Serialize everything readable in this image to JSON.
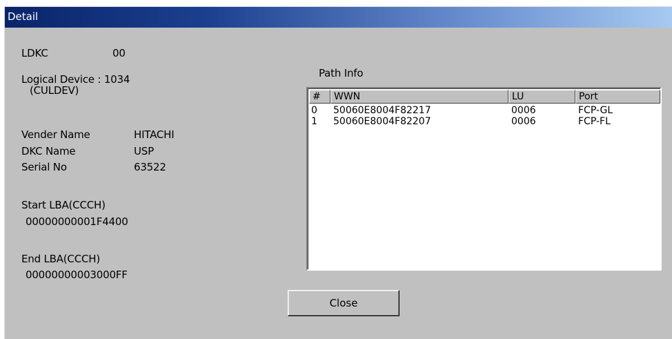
{
  "window": {
    "title": "Detail"
  },
  "device": {
    "ldkc_label": "LDKC",
    "ldkc_value": "00",
    "logical_device_label": "Logical Device : 1034",
    "logical_device_sub": "(CULDEV)",
    "vender_name_label": "Vender Name",
    "vender_name_value": "HITACHI",
    "dkc_name_label": "DKC Name",
    "dkc_name_value": "USP",
    "serial_no_label": "Serial No",
    "serial_no_value": "63522",
    "start_lba_label": "Start LBA(CCCH)",
    "start_lba_value": "00000000001F4400",
    "end_lba_label": "End LBA(CCCH)",
    "end_lba_value": "00000000003000FF"
  },
  "path_info": {
    "label": "Path Info",
    "columns": [
      "#",
      "WWN",
      "LU",
      "Port"
    ],
    "rows": [
      {
        "num": "0",
        "wwn": "50060E8004F82217",
        "lu": "0006",
        "port": "FCP-GL"
      },
      {
        "num": "1",
        "wwn": "50060E8004F82207",
        "lu": "0006",
        "port": "FCP-FL"
      }
    ]
  },
  "buttons": {
    "close_label": "Close"
  }
}
